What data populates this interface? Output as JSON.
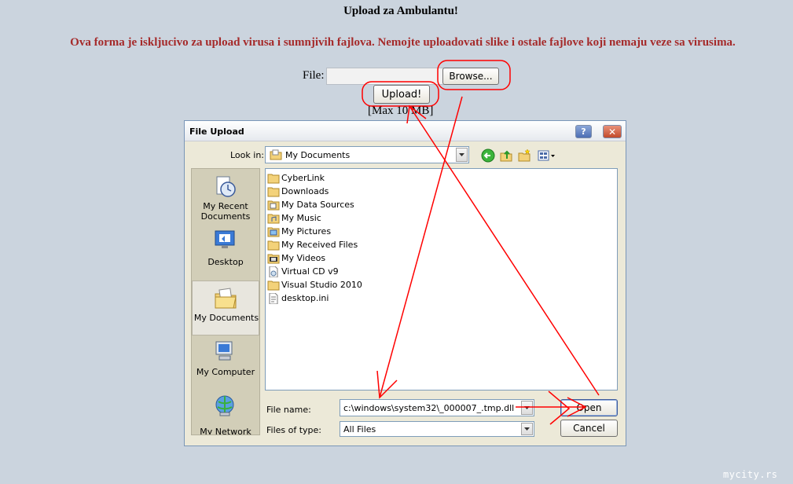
{
  "page": {
    "title": "Upload za Ambulantu!",
    "warning": "Ova forma je iskljucivo za upload virusa i sumnjivih fajlova. Nemojte uploadovati slike i ostale fajlove koji nemaju veze sa virusima.",
    "file_label": "File:",
    "browse_label": "Browse...",
    "upload_label": "Upload!",
    "max_size": "[Max 10 MB]"
  },
  "dialog": {
    "title": "File Upload",
    "help_label": "?",
    "close_label": "✕",
    "look_in_label": "Look in:",
    "look_in_value": "My Documents",
    "places": [
      {
        "label": "My Recent Documents",
        "icon": "recent-documents-icon"
      },
      {
        "label": "Desktop",
        "icon": "desktop-icon"
      },
      {
        "label": "My Documents",
        "icon": "my-documents-icon"
      },
      {
        "label": "My Computer",
        "icon": "my-computer-icon"
      },
      {
        "label": "My Network",
        "icon": "my-network-icon"
      }
    ],
    "files": [
      {
        "name": "CyberLink",
        "icon": "folder-icon"
      },
      {
        "name": "Downloads",
        "icon": "folder-icon"
      },
      {
        "name": "My Data Sources",
        "icon": "data-sources-folder-icon"
      },
      {
        "name": "My Music",
        "icon": "music-folder-icon"
      },
      {
        "name": "My Pictures",
        "icon": "pictures-folder-icon"
      },
      {
        "name": "My Received Files",
        "icon": "folder-icon"
      },
      {
        "name": "My Videos",
        "icon": "videos-folder-icon"
      },
      {
        "name": "Virtual CD v9",
        "icon": "file-icon"
      },
      {
        "name": "Visual Studio 2010",
        "icon": "folder-icon"
      },
      {
        "name": "desktop.ini",
        "icon": "ini-file-icon"
      }
    ],
    "file_name_label": "File name:",
    "file_name_value": "c:\\windows\\system32\\_000007_.tmp.dll",
    "file_type_label": "Files of type:",
    "file_type_value": "All Files",
    "open_label": "Open",
    "cancel_label": "Cancel"
  },
  "colors": {
    "background": "#cbd4de",
    "warning": "#a52a2a",
    "annotation": "#ff0000"
  },
  "watermark": "mycity.rs"
}
